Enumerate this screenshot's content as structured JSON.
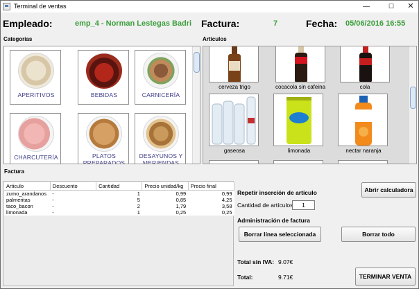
{
  "window": {
    "title": "Terminal de ventas"
  },
  "header": {
    "empleado_label": "Empleado:",
    "empleado_value": "emp_4 - Norman Lestegas Badri",
    "factura_label": "Factura:",
    "factura_value": "7",
    "fecha_label": "Fecha:",
    "fecha_value": "05/06/2016 16:55"
  },
  "categorias": {
    "label": "Categorías",
    "items": [
      {
        "name": "APERITIVOS"
      },
      {
        "name": "BEBIDAS"
      },
      {
        "name": "CARNICERÍA"
      },
      {
        "name": "CHARCUTERÍA"
      },
      {
        "name": "PLATOS PREPARADOS"
      },
      {
        "name": "DESAYUNOS Y MERIENDAS"
      }
    ]
  },
  "articulos": {
    "label": "Artículos",
    "items": [
      {
        "name": "cerveza trigo"
      },
      {
        "name": "cocacola sin cafeina"
      },
      {
        "name": "cola"
      },
      {
        "name": "gaseosa"
      },
      {
        "name": "limonada"
      },
      {
        "name": "nectar naranja"
      }
    ]
  },
  "factura": {
    "label": "Factura",
    "columns": [
      "Articulo",
      "Descuento",
      "Cantidad",
      "Precio unidad/kg",
      "Precio final"
    ],
    "rows": [
      {
        "articulo": "zumo_arandanos",
        "descuento": "-",
        "cantidad": "1",
        "precio_unidad": "0,99",
        "precio_final": "0,99"
      },
      {
        "articulo": "palmeritas",
        "descuento": "-",
        "cantidad": "5",
        "precio_unidad": "0,85",
        "precio_final": "4,25"
      },
      {
        "articulo": "taco_bacon",
        "descuento": "-",
        "cantidad": "2",
        "precio_unidad": "1,79",
        "precio_final": "3,58"
      },
      {
        "articulo": "limonada",
        "descuento": "-",
        "cantidad": "1",
        "precio_unidad": "0,25",
        "precio_final": "0,25"
      }
    ]
  },
  "controls": {
    "abrir_calculadora": "Abrir calculadora",
    "repetir_label": "Repetir inserción de artículo",
    "cantidad_label": "Cantidad de artículos:",
    "cantidad_value": "1",
    "admin_label": "Administración de factura",
    "borrar_linea": "Borrar línea seleccionada",
    "borrar_todo": "Borrar todo",
    "total_sin_iva_label": "Total sin IVA:",
    "total_sin_iva_value": "9.07€",
    "total_label": "Total:",
    "total_value": "9.71€",
    "terminar_venta": "TERMINAR VENTA"
  },
  "colors": {
    "accent_green": "#3b9e3b",
    "category_text": "#3a3a86"
  }
}
